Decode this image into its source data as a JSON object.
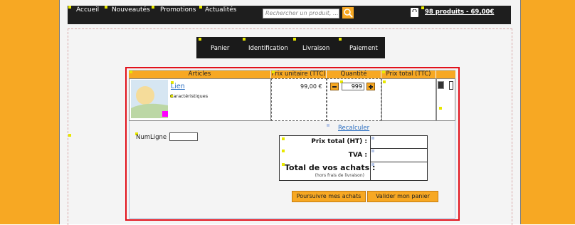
{
  "topnav": {
    "items": [
      "Accueil",
      "Nouveautés",
      "Promotions",
      "Actualités"
    ],
    "search_placeholder": "Rechercher un produit, ...",
    "cart_text": "98 produits - 69,00€"
  },
  "steps": [
    "Panier",
    "Identification",
    "Livraison",
    "Paiement"
  ],
  "cart_table": {
    "headers": [
      "Articles",
      "Prix unitaire (TTC)",
      "Quantité",
      "Prix total (TTC)"
    ],
    "row": {
      "name_link": "Lien",
      "characteristics": "Caractéristiques",
      "unit_price": "99,00 €",
      "quantity": "999"
    }
  },
  "num_ligne_label": "NumLigne",
  "recalc_link": "Recalculer",
  "totals": {
    "ht_label": "Prix total (HT) :",
    "tva_label": "TVA :",
    "total_label": "Total de vos achats :",
    "total_note": "(hors frais de livraison)"
  },
  "buttons": {
    "continue": "Poursuivre mes achats",
    "validate": "Valider mon panier"
  },
  "colors": {
    "accent": "#f7a823",
    "highlight": "#e1111b",
    "dark": "#1e1e1e",
    "link": "#2a6ec1"
  }
}
